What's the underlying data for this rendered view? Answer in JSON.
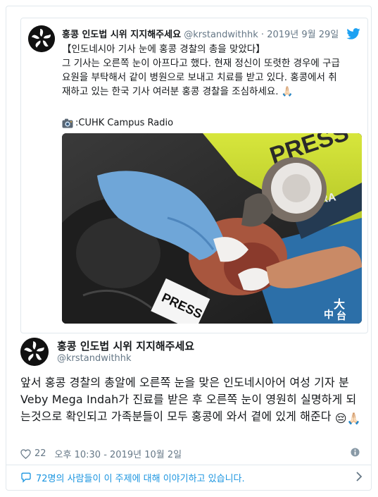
{
  "quoted_tweet": {
    "name": "홍콩 인도법 시위 지지해주세요",
    "handle": "@krstandwithhk",
    "separator": "·",
    "date": "2019년 9월 29일",
    "lines": [
      "【인도네시아 기사 눈에 홍콩 경찰의 총을 맞았다】",
      "그 기사는 오른쪽 눈이 아프다고 했다. 현재 정신이 또렷한 경우에 구급",
      "요원을 부탁해서 같이 병원으로 보내고 치료를 받고 있다. 홍콩에서 취",
      "재하고 있는 한국 기사 여러분 홍콩 경찰을 조심하세요. 🙏🏻"
    ],
    "source": ":CUHK Campus Radio",
    "photo_text": {
      "press_vest": "PRESS",
      "suara": "SUARA",
      "press_tag": "PRESS",
      "watermark": [
        "大",
        "中",
        "台"
      ]
    }
  },
  "tweet": {
    "name": "홍콩 인도법 시위 지지해주세요",
    "handle": "@krstandwithhk",
    "body": "앞서 홍콩 경찰의 총알에 오른쪽 눈을 맞은 인도네시아어 여성 기자 분 Veby Mega Indah가 진료를 받은 후 오른쪽 눈이 영원히 실명하게 되는것으로 확인되고 가족분들이 모두 홍콩에 와서 곁에 있게 해준다",
    "emoji": "😔🙏🏻",
    "likes": "22",
    "time": "오후 10:30 - 2019년 10월 2일"
  },
  "footer": {
    "conversation": "72명의 사람들이 이 주제에 대해 이야기하고 있습니다."
  },
  "colors": {
    "link": "#1b95e0",
    "muted": "#657786",
    "border": "#e1e8ed"
  },
  "icons": [
    "twitter-bird-icon",
    "camera-icon",
    "heart-icon",
    "info-icon",
    "speech-bubble-icon",
    "chevron-right-icon"
  ]
}
